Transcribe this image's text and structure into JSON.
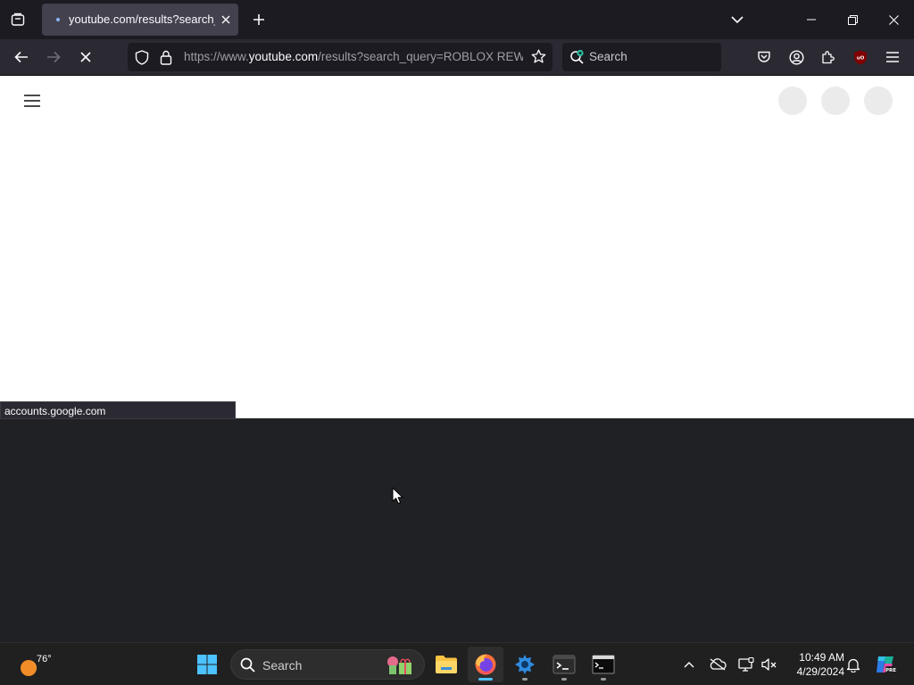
{
  "browser": {
    "tab": {
      "title": "youtube.com/results?search_query=ROBLOX REWORK"
    },
    "urlbar": {
      "prefix": "https://www.",
      "domain": "youtube.com",
      "rest": "/results?search_query=ROBLOX REWORK"
    },
    "search": {
      "placeholder": "Search"
    }
  },
  "page": {
    "status_text": "accounts.google.com"
  },
  "taskbar": {
    "weather": {
      "temp": "76°"
    },
    "search": {
      "placeholder": "Search"
    },
    "clock": {
      "time": "10:49 AM",
      "date": "4/29/2024"
    }
  },
  "colors": {
    "accent": "#4cc2ff",
    "ublock": "#800000",
    "tab_bg": "#42414d"
  }
}
